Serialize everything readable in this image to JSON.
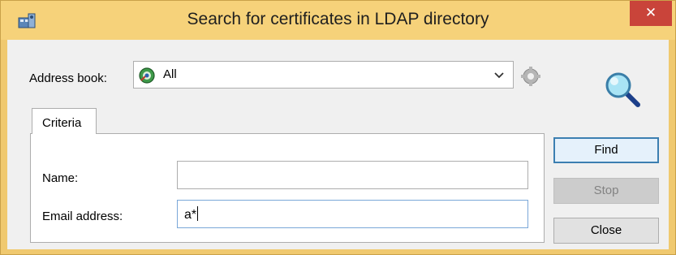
{
  "window": {
    "title": "Search for certificates in LDAP directory",
    "close_glyph": "✕",
    "title_icon": "address-book-app-icon"
  },
  "address_book": {
    "label": "Address book:",
    "selected": "All",
    "selected_icon": "directory-globe-icon",
    "settings_icon": "directory-settings-icon"
  },
  "search_icon": "magnifier-icon",
  "tabs": [
    {
      "label": "Criteria",
      "active": true
    }
  ],
  "criteria": {
    "name_label": "Name:",
    "name_value": "",
    "email_label": "Email address:",
    "email_value": "a*"
  },
  "buttons": {
    "find": "Find",
    "stop": "Stop",
    "close": "Close"
  },
  "colors": {
    "title_bar": "#f6d27a",
    "close_button": "#c9443a",
    "default_button_border": "#3c7fb1",
    "focused_input_border": "#7aa7d8"
  }
}
